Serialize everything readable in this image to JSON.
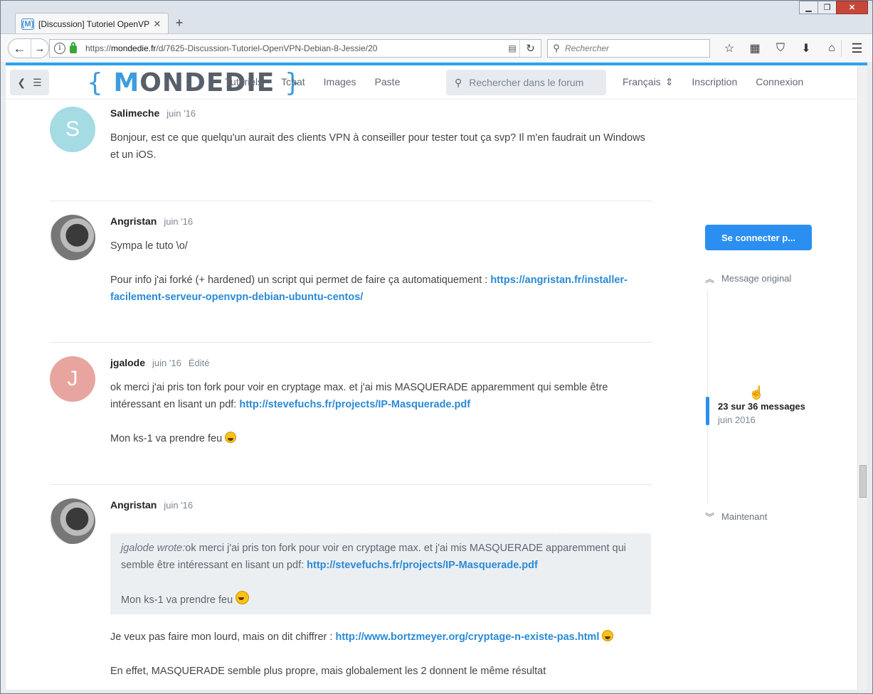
{
  "browser": {
    "tab_title": "[Discussion] Tutoriel OpenVP",
    "tab_favicon": "{M}",
    "new_tab": "+",
    "url_prefix": "https://",
    "url_host": "mondedie.fr",
    "url_path": "/d/7625-Discussion-Tutoriel-OpenVPN-Debian-8-Jessie/20",
    "search_placeholder": "Rechercher",
    "toolbar_icons": [
      "bookmark-star-icon",
      "reading-list-icon",
      "pocket-icon",
      "download-icon",
      "home-icon"
    ]
  },
  "site": {
    "logo_open": "{",
    "logo_m": "M",
    "logo_rest": "ONDEDIE",
    "logo_close": "}",
    "nav": [
      "Tutoriels",
      "Tchat",
      "Images",
      "Paste"
    ],
    "search_placeholder": "Rechercher dans le forum",
    "language": "Français",
    "signup": "Inscription",
    "login": "Connexion",
    "accent": "#2a8ff1"
  },
  "posts": [
    {
      "user": "Salimeche",
      "avatar_letter": "S",
      "avatar_color": "#a5dbe2",
      "date": "juin '16",
      "text1": "Bonjour, est ce que quelqu'un aurait des clients VPN à conseiller pour tester tout ça svp? Il m'en faudrait un Windows et un iOS."
    },
    {
      "user": "Angristan",
      "date": "juin '16",
      "text1": "Sympa le tuto \\o/",
      "text2": "Pour info j'ai forké (+ hardened) un script qui permet de faire ça automatiquement : ",
      "link": "https://angristan.fr/installer-facilement-serveur-openvpn-debian-ubuntu-centos/"
    },
    {
      "user": "jgalode",
      "avatar_letter": "J",
      "avatar_color": "#e8a49e",
      "date": "juin '16",
      "edited": "Édité",
      "text1": "ok merci j'ai pris ton fork pour voir en cryptage max. et j'ai mis MASQUERADE apparemment qui semble être intéressant en lisant un pdf: ",
      "link": "http://stevefuchs.fr/projects/IP-Masquerade.pdf",
      "text2": "Mon ks-1 va prendre feu "
    },
    {
      "user": "Angristan",
      "date": "juin '16",
      "quote_author": "jgalode wrote:",
      "quote_text1": "ok merci j'ai pris ton fork pour voir en cryptage max. et j'ai mis MASQUERADE apparemment qui semble être intéressant en lisant un pdf: ",
      "quote_link": "http://stevefuchs.fr/projects/IP-Masquerade.pdf",
      "quote_text2": "Mon ks-1 va prendre feu ",
      "text1": "Je veux pas faire mon lourd, mais on dit chiffrer : ",
      "link": "http://www.bortzmeyer.org/cryptage-n-existe-pas.html",
      "text2": "En effet, MASQUERADE semble plus propre, mais globalement les 2 donnent le même résultat"
    }
  ],
  "sidebar": {
    "login_button": "Se connecter p...",
    "original": "Message original",
    "position": "23 sur 36 messages",
    "position_date": "juin 2016",
    "now": "Maintenant"
  }
}
